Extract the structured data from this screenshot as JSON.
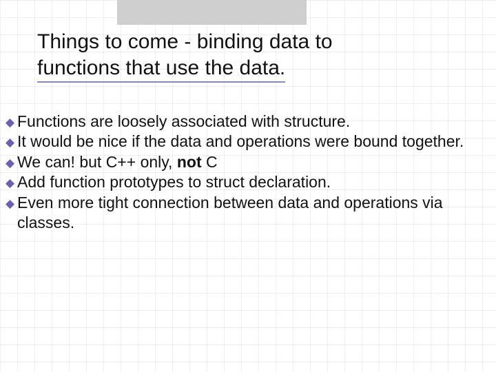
{
  "title": {
    "line1": "Things to come - binding data to",
    "line2": "functions that use the data."
  },
  "bullets": [
    {
      "html": "Functions are loosely associated with structure."
    },
    {
      "html": "It would be nice if the data and operations were bound together."
    },
    {
      "html": "We can! but C++ only, <b>not</b> C"
    },
    {
      "html": "Add function prototypes to struct declaration."
    },
    {
      "html": "Even more tight connection between data and operations via classes."
    }
  ]
}
